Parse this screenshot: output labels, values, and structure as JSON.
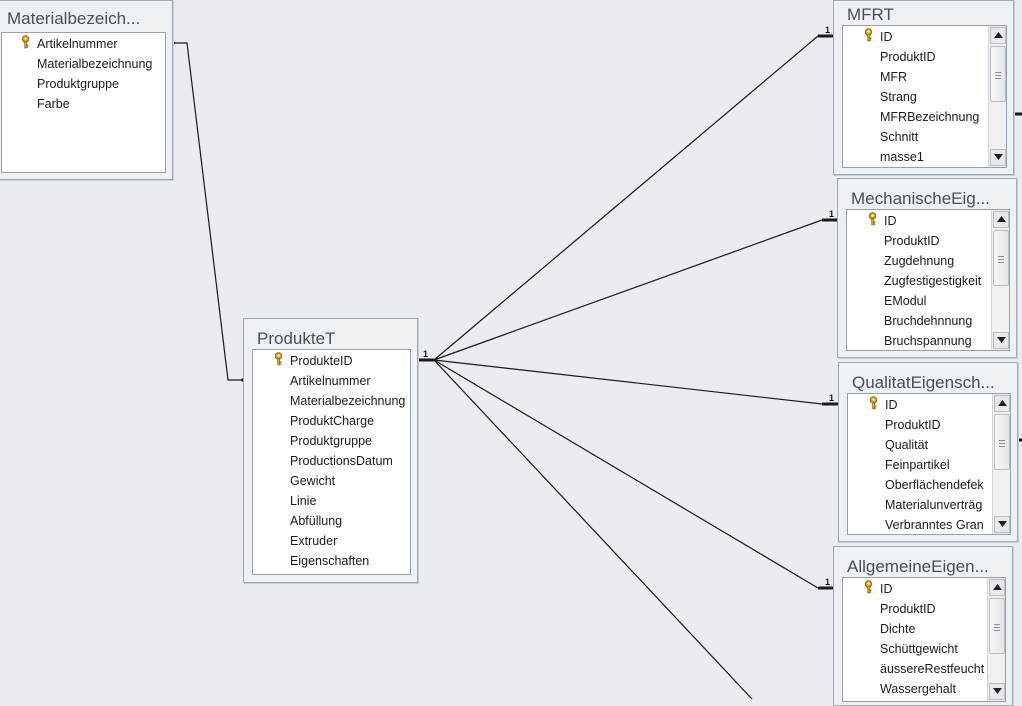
{
  "tables": {
    "materialbezeichnung": {
      "title": "Materialbezeich...",
      "fields": [
        {
          "name": "Artikelnummer",
          "key": true
        },
        {
          "name": "Materialbezeichnung",
          "key": false
        },
        {
          "name": "Produktgruppe",
          "key": false
        },
        {
          "name": "Farbe",
          "key": false
        }
      ]
    },
    "produktet": {
      "title": "ProdukteT",
      "fields": [
        {
          "name": "ProdukteID",
          "key": true
        },
        {
          "name": "Artikelnummer",
          "key": false
        },
        {
          "name": "Materialbezeichnung",
          "key": false
        },
        {
          "name": "ProduktCharge",
          "key": false
        },
        {
          "name": "Produktgruppe",
          "key": false
        },
        {
          "name": "ProductionsDatum",
          "key": false
        },
        {
          "name": "Gewicht",
          "key": false
        },
        {
          "name": "Linie",
          "key": false
        },
        {
          "name": "Abfüllung",
          "key": false
        },
        {
          "name": "Extruder",
          "key": false
        },
        {
          "name": "Eigenschaften",
          "key": false
        }
      ]
    },
    "mfrt": {
      "title": "MFRT",
      "fields": [
        {
          "name": "ID",
          "key": true
        },
        {
          "name": "ProduktID",
          "key": false
        },
        {
          "name": "MFR",
          "key": false
        },
        {
          "name": "Strang",
          "key": false
        },
        {
          "name": "MFRBezeichnung",
          "key": false
        },
        {
          "name": "Schnitt",
          "key": false
        },
        {
          "name": "masse1",
          "key": false
        }
      ]
    },
    "mechanische": {
      "title": "MechanischeEig...",
      "fields": [
        {
          "name": "ID",
          "key": true
        },
        {
          "name": "ProduktID",
          "key": false
        },
        {
          "name": "Zugdehnung",
          "key": false
        },
        {
          "name": "Zugfestigestigkeit",
          "key": false
        },
        {
          "name": "EModul",
          "key": false
        },
        {
          "name": "Bruchdehnnung",
          "key": false
        },
        {
          "name": "Bruchspannung",
          "key": false
        }
      ]
    },
    "qualitat": {
      "title": "QualitatEigensch...",
      "fields": [
        {
          "name": "ID",
          "key": true
        },
        {
          "name": "ProduktID",
          "key": false
        },
        {
          "name": "Qualität",
          "key": false
        },
        {
          "name": "Feinpartikel",
          "key": false
        },
        {
          "name": "Oberflächendefek",
          "key": false
        },
        {
          "name": "Materialunverträg",
          "key": false
        },
        {
          "name": "Verbranntes Gran",
          "key": false
        }
      ]
    },
    "allgemeine": {
      "title": "AllgemeineEigen...",
      "fields": [
        {
          "name": "ID",
          "key": true
        },
        {
          "name": "ProduktID",
          "key": false
        },
        {
          "name": "Dichte",
          "key": false
        },
        {
          "name": "Schüttgewicht",
          "key": false
        },
        {
          "name": "äussereRestfeucht",
          "key": false
        },
        {
          "name": "Wassergehalt",
          "key": false
        }
      ]
    }
  },
  "relationships": {
    "one_label": "1",
    "many_label": "∞"
  },
  "colors": {
    "key_icon": "#d7a21a",
    "line": "#1a1a1a",
    "background": "#e9ecf0"
  }
}
